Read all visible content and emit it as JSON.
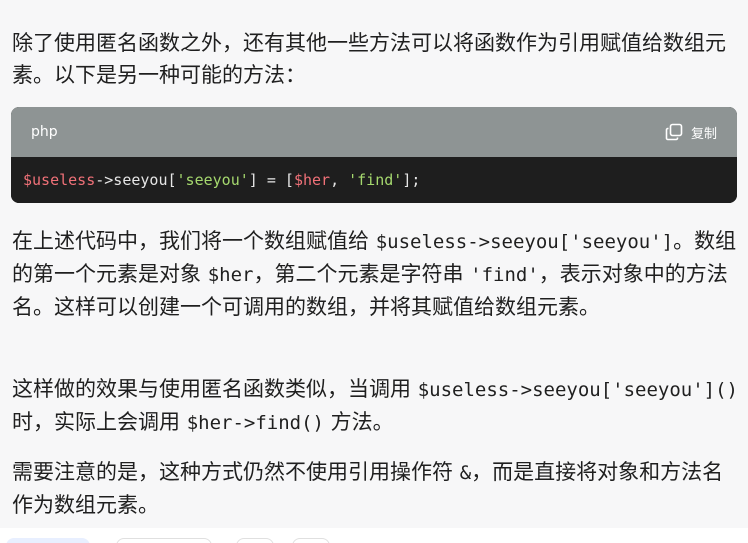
{
  "paragraphs": {
    "p1": "除了使用匿名函数之外，还有其他一些方法可以将函数作为引用赋值给数组元素。以下是另一种可能的方法：",
    "p2_a": "在上述代码中，我们将一个数组赋值给 ",
    "p2_code1": "$useless->seeyou['seeyou']",
    "p2_b": "。数组的第一个元素是对象 ",
    "p2_code2": "$her",
    "p2_c": "，第二个元素是字符串 ",
    "p2_code3": "'find'",
    "p2_d": "，表示对象中的方法名。这样可以创建一个可调用的数组，并将其赋值给数组元素。",
    "p3_a": "这样做的效果与使用匿名函数类似，当调用 ",
    "p3_code1": "$useless->seeyou['seeyou']()",
    "p3_b": " 时，实际上会调用 ",
    "p3_code2": "$her->find()",
    "p3_c": " 方法。",
    "p4_a": "需要注意的是，这种方式仍然不使用引用操作符 ",
    "p4_code1": "&",
    "p4_b": "，而是直接将对象和方法名作为数组元素。"
  },
  "code_block": {
    "language": "php",
    "copy_label": "复制",
    "copy_icon": "copy-icon",
    "tokens": {
      "t1": "$useless",
      "t2": "->seeyou[",
      "t3": "'seeyou'",
      "t4": "] = [",
      "t5": "$her",
      "t6": ", ",
      "t7": "'find'",
      "t8": "];"
    }
  },
  "colors": {
    "header_bg": "#8e9494",
    "code_bg": "#1e1e1e",
    "variable": "#f07178",
    "string": "#a5d86e"
  }
}
